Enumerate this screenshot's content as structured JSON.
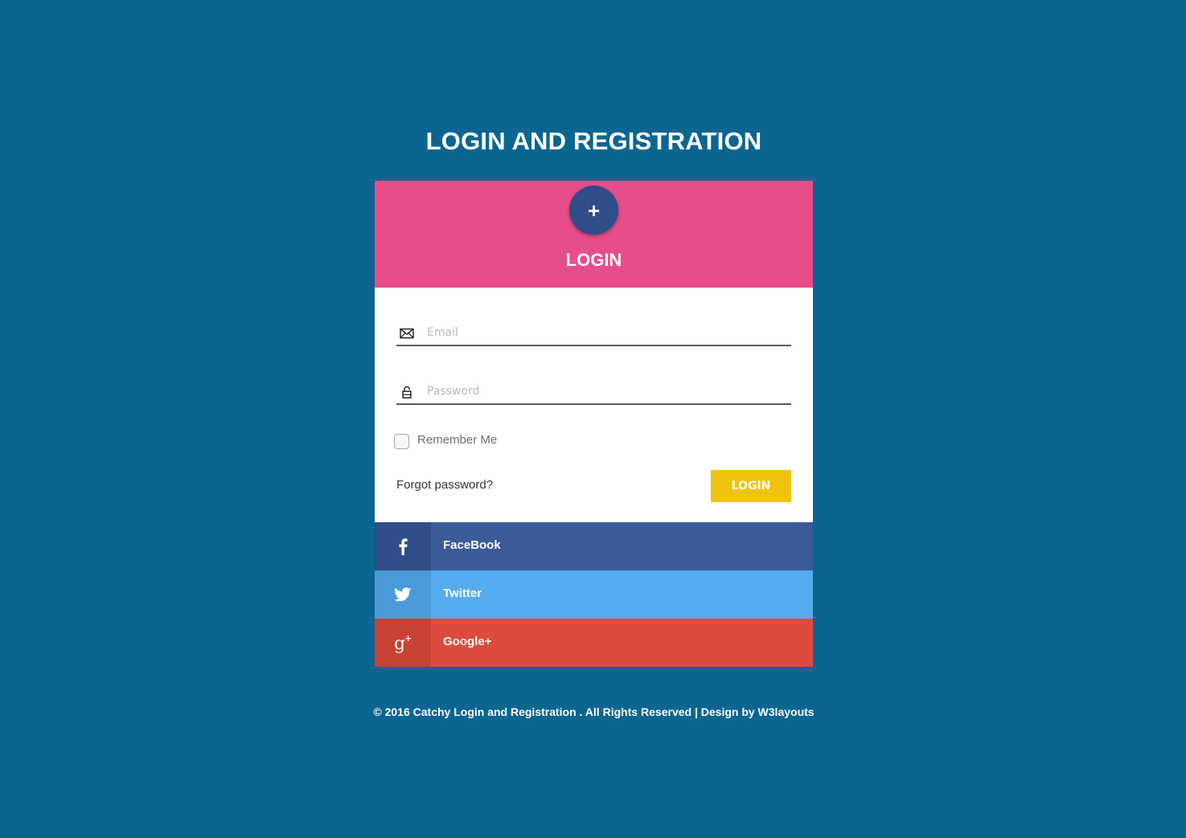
{
  "page_title": "LOGIN AND REGISTRATION",
  "card": {
    "plus_label": "+",
    "header_title": "LOGIN",
    "email": {
      "placeholder": "Email",
      "value": ""
    },
    "password": {
      "placeholder": "Password",
      "value": ""
    },
    "remember_label": "Remember Me",
    "remember_checked": false,
    "forgot_label": "Forgot password?",
    "login_button": "LOGIN"
  },
  "social": [
    {
      "label": "FaceBook",
      "icon": "facebook-icon",
      "color": "#3b5a9a"
    },
    {
      "label": "Twitter",
      "icon": "twitter-icon",
      "color": "#55acee"
    },
    {
      "label": "Google+",
      "icon": "google-plus-icon",
      "color": "#dd4b3e"
    }
  ],
  "footer": "© 2016 Catchy Login and Registration . All Rights Reserved | Design by W3layouts",
  "colors": {
    "background": "#0c6591",
    "header": "#e84d8b",
    "plus_circle": "#2f4d89",
    "login_button": "#f0c30f"
  }
}
